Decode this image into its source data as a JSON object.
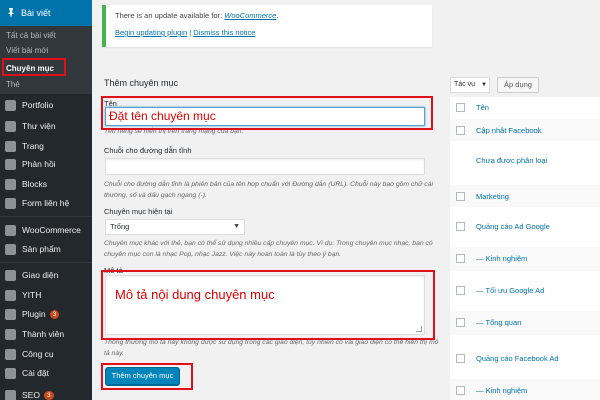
{
  "sidebar": {
    "active_menu": "Bài viết",
    "submenu": [
      "Tất cả bài viết",
      "Viết bài mới",
      "Chuyên mục",
      "Thẻ"
    ],
    "items": [
      {
        "label": "Portfolio",
        "icon": "portfolio-icon"
      },
      {
        "label": "Thư viện",
        "icon": "media-icon"
      },
      {
        "label": "Trang",
        "icon": "pages-icon"
      },
      {
        "label": "Phản hồi",
        "icon": "comments-icon"
      },
      {
        "label": "Blocks",
        "icon": "blocks-icon"
      },
      {
        "label": "Form liên hệ",
        "icon": "mail-icon"
      },
      {
        "label": "WooCommerce",
        "icon": "woocommerce-icon"
      },
      {
        "label": "Sản phẩm",
        "icon": "products-icon"
      },
      {
        "label": "Giao diện",
        "icon": "appearance-icon"
      },
      {
        "label": "YITH",
        "icon": "yith-icon"
      },
      {
        "label": "Plugin",
        "icon": "plugins-icon",
        "badge": "3"
      },
      {
        "label": "Thành viên",
        "icon": "users-icon"
      },
      {
        "label": "Công cụ",
        "icon": "tools-icon"
      },
      {
        "label": "Cài đặt",
        "icon": "settings-icon"
      },
      {
        "label": "SEO",
        "icon": "seo-icon",
        "badge": "3"
      }
    ]
  },
  "notice": {
    "text": "There is an update available for: ",
    "link": "WooCommerce",
    "link_suffix": ".",
    "action1": "Begin updating plugin",
    "divider": " | ",
    "action2": "Dismiss this notice"
  },
  "form": {
    "title": "Thêm chuyên mục",
    "name_label": "Tên",
    "name_value": "Đặt tên chuyên mục",
    "name_help": "Tên riêng sẽ hiển thị trên trang mạng của bạn.",
    "slug_label": "Chuỗi cho đường dẫn tĩnh",
    "slug_value": "",
    "slug_help": "Chuỗi cho đường dẫn tĩnh là phiên bản của tên hợp chuẩn với Đường dẫn (URL). Chuỗi này bao gồm chữ cái thường, số và dấu gạch ngang (-).",
    "parent_label": "Chuyên mục hiện tại",
    "parent_value": "Trống",
    "parent_help": "Chuyên mục khác với thẻ, bạn có thể sử dụng nhiều cấp chuyên mục. Ví dụ: Trong chuyên mục nhạc, bạn có chuyên mục con là nhạc Pop, nhạc Jazz. Việc này hoàn toàn là tùy theo ý bạn.",
    "desc_label": "Mô tả",
    "desc_value": "Mô tả nội dung chuyên mục",
    "desc_help": "Thông thường mô tả này không được sử dụng trong các giao diện, tuy nhiên có vài giao diện có thể hiển thị mô tả này.",
    "submit_label": "Thêm chuyên mục"
  },
  "list": {
    "bulk_label": "Tác vụ",
    "apply_label": "Áp dụng",
    "header": "Tên",
    "rows": [
      "Cập nhật Facebook",
      "Chưa được phân loại",
      "Marketing",
      "Quảng cáo Ad Google",
      "— Kinh nghiệm",
      "— Tối ưu Google Ad",
      "— Tổng quan",
      "Quảng cáo Facebook Ad",
      "— Kinh nghiệm"
    ]
  },
  "colors": {
    "sidebar_bg": "#23282d",
    "active_blue": "#0073aa",
    "highlight_red": "#e0101a",
    "notice_green": "#46b450"
  }
}
